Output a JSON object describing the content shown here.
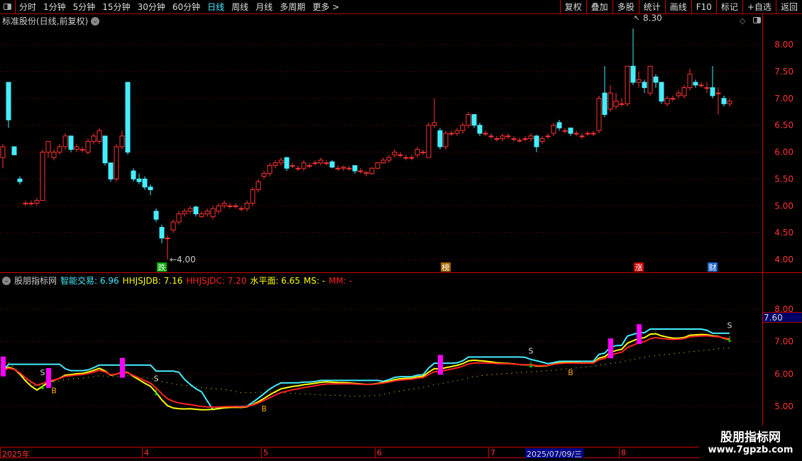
{
  "toolbar": {
    "periods": [
      "分时",
      "1分钟",
      "5分钟",
      "15分钟",
      "30分钟",
      "60分钟",
      "日线",
      "周线",
      "月线",
      "多周期",
      "更多 >"
    ],
    "active_period": "日线",
    "tools": [
      "复权",
      "叠加",
      "多股",
      "统计",
      "画线",
      "F10",
      "标记",
      "+自选",
      "返回"
    ]
  },
  "main": {
    "title": "标准股份(日线,前复权)",
    "max_label": "8.30",
    "min_label": "4.00",
    "price_axis": [
      "8.00",
      "7.50",
      "7.00",
      "6.50",
      "6.00",
      "5.50",
      "5.00",
      "4.50",
      "4.00"
    ],
    "events": [
      {
        "label": "跌",
        "idx": 28,
        "color": "#0a0"
      },
      {
        "label": "榜",
        "idx": 78,
        "color": "#a60"
      },
      {
        "label": "涨",
        "idx": 112,
        "color": "#c00"
      },
      {
        "label": "财",
        "idx": 125,
        "color": "#26c"
      }
    ]
  },
  "indicator": {
    "name": "股朋指标网",
    "items": [
      {
        "label": "智能交易: 6.96",
        "color": "#4ef"
      },
      {
        "label": "HHJSJDB: 7.16",
        "color": "#ff0"
      },
      {
        "label": "HHJSJDC: 7.20",
        "color": "#f22"
      },
      {
        "label": "水平面: 6.65",
        "color": "#ff0"
      },
      {
        "label": "MS: -",
        "color": "#ff0"
      },
      {
        "label": "MM: -",
        "color": "#f22"
      }
    ],
    "axis": [
      "8.00",
      "7.00",
      "6.00",
      "5.00"
    ],
    "cursor_value": "7.60",
    "signals": [
      {
        "type": "S",
        "idx": 7
      },
      {
        "type": "B",
        "idx": 9
      },
      {
        "type": "S",
        "idx": 27
      },
      {
        "type": "B",
        "idx": 46
      },
      {
        "type": "S",
        "idx": 93
      },
      {
        "type": "B",
        "idx": 100
      },
      {
        "type": "S",
        "idx": 128
      }
    ],
    "bars": [
      0,
      8,
      21,
      77,
      107,
      112
    ]
  },
  "dates": {
    "labels": [
      {
        "text": "2025年",
        "idx": 0
      },
      {
        "text": "4",
        "idx": 25
      },
      {
        "text": "5",
        "idx": 46
      },
      {
        "text": "6",
        "idx": 66
      },
      {
        "text": "7",
        "idx": 86
      },
      {
        "text": "8",
        "idx": 109
      }
    ],
    "cursor": "2025/07/09/三"
  },
  "watermark": {
    "site": "股朋指标网",
    "url": "www.7gpzb.com"
  },
  "candles": [
    [
      5.9,
      6.1,
      6.15,
      5.7
    ],
    [
      7.3,
      6.6,
      7.3,
      6.45
    ],
    [
      6.1,
      5.95,
      6.1,
      5.95
    ],
    [
      5.5,
      5.45,
      5.55,
      5.4
    ],
    [
      5.05,
      5.05,
      5.1,
      5.0
    ],
    [
      5.05,
      5.05,
      5.1,
      5.0
    ],
    [
      5.05,
      5.1,
      5.15,
      5.0
    ],
    [
      5.1,
      6.0,
      6.05,
      5.1
    ],
    [
      6.0,
      6.2,
      6.2,
      5.9
    ],
    [
      5.9,
      6.0,
      6.05,
      5.85
    ],
    [
      6.0,
      6.1,
      6.15,
      5.95
    ],
    [
      6.1,
      6.3,
      6.35,
      6.05
    ],
    [
      6.3,
      6.05,
      6.3,
      6.0
    ],
    [
      6.05,
      6.1,
      6.15,
      6.0
    ],
    [
      6.05,
      6.05,
      6.1,
      6.0
    ],
    [
      6.0,
      6.2,
      6.25,
      5.95
    ],
    [
      6.2,
      6.3,
      6.35,
      6.15
    ],
    [
      6.2,
      6.4,
      6.45,
      6.15
    ],
    [
      6.3,
      5.8,
      6.3,
      5.75
    ],
    [
      5.8,
      5.5,
      5.8,
      5.45
    ],
    [
      5.5,
      6.1,
      6.15,
      5.45
    ],
    [
      6.1,
      6.3,
      6.4,
      6.05
    ],
    [
      7.3,
      6.0,
      7.3,
      5.95
    ],
    [
      5.65,
      5.5,
      5.7,
      5.45
    ],
    [
      5.5,
      5.45,
      5.6,
      5.4
    ],
    [
      5.5,
      5.35,
      5.55,
      5.3
    ],
    [
      5.35,
      5.3,
      5.4,
      5.2
    ],
    [
      4.9,
      4.75,
      4.95,
      4.7
    ],
    [
      4.6,
      4.4,
      4.65,
      4.3
    ],
    [
      4.4,
      4.4,
      4.45,
      4.0
    ],
    [
      4.55,
      4.7,
      4.75,
      4.5
    ],
    [
      4.7,
      4.85,
      4.9,
      4.65
    ],
    [
      4.85,
      4.9,
      4.95,
      4.8
    ],
    [
      4.9,
      4.95,
      5.0,
      4.85
    ],
    [
      4.98,
      4.85,
      5.0,
      4.8
    ],
    [
      4.8,
      4.85,
      4.9,
      4.78
    ],
    [
      4.85,
      4.9,
      4.95,
      4.8
    ],
    [
      4.8,
      4.95,
      5.0,
      4.75
    ],
    [
      4.9,
      5.0,
      5.05,
      4.85
    ],
    [
      5.0,
      5.05,
      5.1,
      4.95
    ],
    [
      5.0,
      5.0,
      5.05,
      4.95
    ],
    [
      5.0,
      5.0,
      5.05,
      4.95
    ],
    [
      4.95,
      4.95,
      5.0,
      4.9
    ],
    [
      4.95,
      5.05,
      5.1,
      4.9
    ],
    [
      5.05,
      5.3,
      5.35,
      5.0
    ],
    [
      5.3,
      5.45,
      5.5,
      5.25
    ],
    [
      5.55,
      5.6,
      5.65,
      5.5
    ],
    [
      5.6,
      5.75,
      5.8,
      5.55
    ],
    [
      5.75,
      5.8,
      5.85,
      5.7
    ],
    [
      5.8,
      5.85,
      5.9,
      5.75
    ],
    [
      5.9,
      5.7,
      5.9,
      5.65
    ],
    [
      5.75,
      5.75,
      5.8,
      5.7
    ],
    [
      5.7,
      5.7,
      5.75,
      5.65
    ],
    [
      5.7,
      5.8,
      5.85,
      5.65
    ],
    [
      5.75,
      5.75,
      5.8,
      5.7
    ],
    [
      5.8,
      5.8,
      5.85,
      5.75
    ],
    [
      5.8,
      5.85,
      5.9,
      5.75
    ],
    [
      5.8,
      5.8,
      5.85,
      5.75
    ],
    [
      5.82,
      5.72,
      5.85,
      5.7
    ],
    [
      5.7,
      5.7,
      5.75,
      5.65
    ],
    [
      5.7,
      5.72,
      5.75,
      5.65
    ],
    [
      5.7,
      5.7,
      5.75,
      5.65
    ],
    [
      5.75,
      5.65,
      5.75,
      5.6
    ],
    [
      5.65,
      5.65,
      5.7,
      5.6
    ],
    [
      5.6,
      5.62,
      5.65,
      5.55
    ],
    [
      5.6,
      5.7,
      5.72,
      5.58
    ],
    [
      5.7,
      5.8,
      5.82,
      5.68
    ],
    [
      5.8,
      5.85,
      5.9,
      5.78
    ],
    [
      5.85,
      5.9,
      5.95,
      5.8
    ],
    [
      5.95,
      6.0,
      6.05,
      5.9
    ],
    [
      5.95,
      5.95,
      6.0,
      5.9
    ],
    [
      5.9,
      5.9,
      5.95,
      5.85
    ],
    [
      5.9,
      5.9,
      5.95,
      5.85
    ],
    [
      5.95,
      6.05,
      6.1,
      5.9
    ],
    [
      6.0,
      6.0,
      6.05,
      5.95
    ],
    [
      5.9,
      6.5,
      6.55,
      5.9
    ],
    [
      6.5,
      6.55,
      7.0,
      6.45
    ],
    [
      6.4,
      6.1,
      6.45,
      6.05
    ],
    [
      6.1,
      6.35,
      6.4,
      6.05
    ],
    [
      6.35,
      6.35,
      6.4,
      6.3
    ],
    [
      6.35,
      6.4,
      6.45,
      6.3
    ],
    [
      6.4,
      6.5,
      6.55,
      6.35
    ],
    [
      6.5,
      6.7,
      6.75,
      6.45
    ],
    [
      6.7,
      6.5,
      6.7,
      6.45
    ],
    [
      6.5,
      6.35,
      6.55,
      6.3
    ],
    [
      6.35,
      6.35,
      6.4,
      6.3
    ],
    [
      6.3,
      6.3,
      6.35,
      6.25
    ],
    [
      6.25,
      6.25,
      6.3,
      6.2
    ],
    [
      6.25,
      6.3,
      6.35,
      6.2
    ],
    [
      6.3,
      6.3,
      6.35,
      6.25
    ],
    [
      6.25,
      6.25,
      6.3,
      6.2
    ],
    [
      6.22,
      6.22,
      6.27,
      6.18
    ],
    [
      6.25,
      6.25,
      6.3,
      6.2
    ],
    [
      6.25,
      6.3,
      6.35,
      6.2
    ],
    [
      6.3,
      6.1,
      6.32,
      6.0
    ],
    [
      6.2,
      6.25,
      6.3,
      6.15
    ],
    [
      6.3,
      6.3,
      6.35,
      6.25
    ],
    [
      6.35,
      6.5,
      6.55,
      6.3
    ],
    [
      6.55,
      6.45,
      6.6,
      6.4
    ],
    [
      6.4,
      6.4,
      6.45,
      6.35
    ],
    [
      6.45,
      6.35,
      6.45,
      6.3
    ],
    [
      6.35,
      6.35,
      6.4,
      6.3
    ],
    [
      6.3,
      6.3,
      6.35,
      6.25
    ],
    [
      6.35,
      6.35,
      6.4,
      6.3
    ],
    [
      6.35,
      6.35,
      6.4,
      6.3
    ],
    [
      6.4,
      7.0,
      7.05,
      6.35
    ],
    [
      7.1,
      6.7,
      7.6,
      6.65
    ],
    [
      6.8,
      7.1,
      7.25,
      6.75
    ],
    [
      6.85,
      6.95,
      7.1,
      6.8
    ],
    [
      6.9,
      6.9,
      7.0,
      6.85
    ],
    [
      6.9,
      7.6,
      7.6,
      6.85
    ],
    [
      7.6,
      7.3,
      8.3,
      7.25
    ],
    [
      7.3,
      7.35,
      7.5,
      7.2
    ],
    [
      7.3,
      7.2,
      7.35,
      7.1
    ],
    [
      7.1,
      7.6,
      7.6,
      7.05
    ],
    [
      7.4,
      7.3,
      7.45,
      7.2
    ],
    [
      7.3,
      6.95,
      7.3,
      6.9
    ],
    [
      6.9,
      7.0,
      7.05,
      6.85
    ],
    [
      7.0,
      7.0,
      7.05,
      6.95
    ],
    [
      7.05,
      7.1,
      7.15,
      7.0
    ],
    [
      7.05,
      7.2,
      7.25,
      7.0
    ],
    [
      7.2,
      7.45,
      7.55,
      7.15
    ],
    [
      7.3,
      7.25,
      7.35,
      7.2
    ],
    [
      7.25,
      7.25,
      7.3,
      7.2
    ],
    [
      7.2,
      7.2,
      7.3,
      7.1
    ],
    [
      7.2,
      7.05,
      7.6,
      7.0
    ],
    [
      7.1,
      7.1,
      7.2,
      6.7
    ],
    [
      7.0,
      6.9,
      7.05,
      6.85
    ],
    [
      6.9,
      6.95,
      7.0,
      6.85
    ]
  ]
}
